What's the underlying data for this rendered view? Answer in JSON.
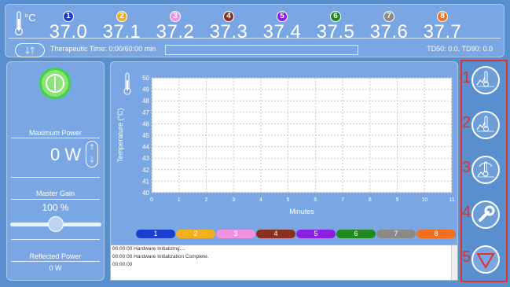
{
  "header": {
    "unit": "°C",
    "channels": [
      {
        "num": "1",
        "value": "37.0",
        "color": "#1a3fcf"
      },
      {
        "num": "2",
        "value": "37.1",
        "color": "#f0b020"
      },
      {
        "num": "3",
        "value": "37.2",
        "color": "#f090e0"
      },
      {
        "num": "4",
        "value": "37.3",
        "color": "#8a3020"
      },
      {
        "num": "5",
        "value": "37.4",
        "color": "#8a20e0"
      },
      {
        "num": "6",
        "value": "37.5",
        "color": "#208a20"
      },
      {
        "num": "7",
        "value": "37.6",
        "color": "#8a8a8a"
      },
      {
        "num": "8",
        "value": "37.7",
        "color": "#f07020"
      }
    ],
    "therapeutic_time": "Therapeutic Time: 0:00/60:00 min",
    "td_values": "TD50: 0.0, TD90: 0.0",
    "progress": 0
  },
  "left": {
    "max_power_label": "Maximum Power",
    "max_power_value": "0 W",
    "master_gain_label": "Master Gain",
    "master_gain_value": "100 %",
    "master_gain_fraction": 1.0,
    "reflected_power_label": "Reflected Power",
    "reflected_power_value": "0 W"
  },
  "chart_data": {
    "type": "line",
    "xlabel": "Minutes",
    "ylabel": "Temperature (°C)",
    "xlim": [
      0,
      11
    ],
    "ylim": [
      40,
      50
    ],
    "x_ticks": [
      "0",
      "1",
      "2",
      "3",
      "4",
      "5",
      "6",
      "7",
      "8",
      "9",
      "10",
      "11"
    ],
    "y_ticks": [
      "40",
      "41",
      "42",
      "43",
      "44",
      "45",
      "46",
      "47",
      "48",
      "49",
      "50"
    ],
    "grid": true,
    "series": []
  },
  "legend": [
    {
      "label": "1",
      "color": "#1a3fcf"
    },
    {
      "label": "2",
      "color": "#f0b020"
    },
    {
      "label": "3",
      "color": "#f090e0"
    },
    {
      "label": "4",
      "color": "#8a3020"
    },
    {
      "label": "5",
      "color": "#8a20e0"
    },
    {
      "label": "6",
      "color": "#208a20"
    },
    {
      "label": "7",
      "color": "#8a8a8a"
    },
    {
      "label": "8",
      "color": "#f07020"
    }
  ],
  "log": [
    "00:00:00 Hardware Initializing....",
    "00:00:00 Hardware Initialization Complete.",
    "00:00:00"
  ],
  "right_buttons": [
    {
      "num": "1",
      "icon": "temperature-chart-icon"
    },
    {
      "num": "2",
      "icon": "temperature-chart-icon"
    },
    {
      "num": "3",
      "icon": "temperature-signal-icon"
    },
    {
      "num": "4",
      "icon": "wrench-icon"
    },
    {
      "num": "5",
      "icon": "down-triangle-icon"
    }
  ]
}
